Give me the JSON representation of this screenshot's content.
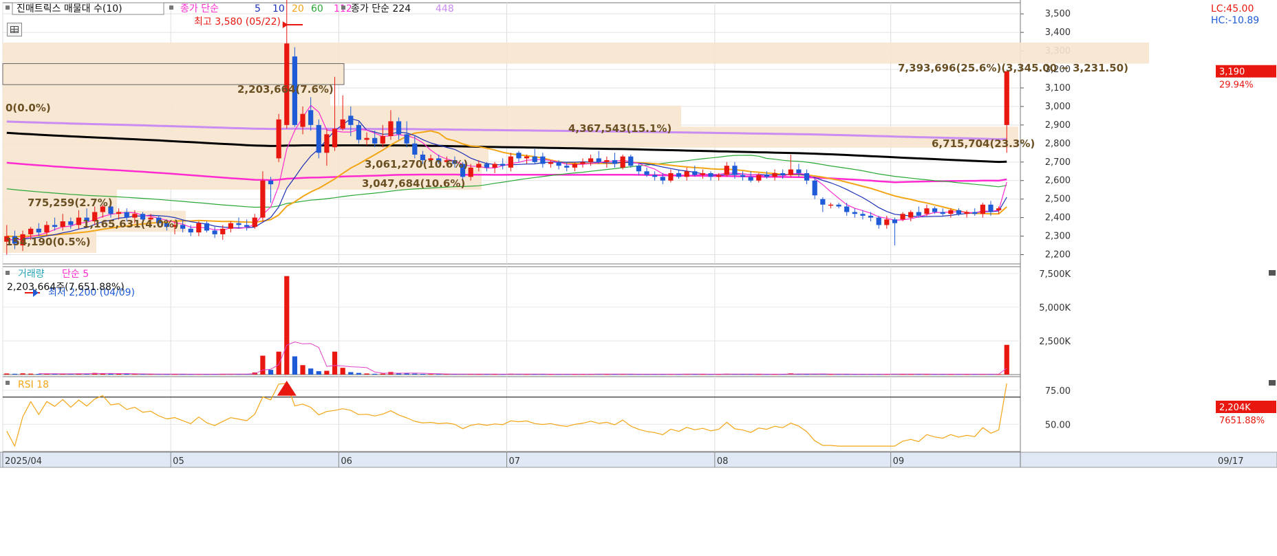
{
  "colors": {
    "up": "#e8170f",
    "down": "#1f5bd6",
    "ma5": "#ff2bd0",
    "ma10": "#1a2fb5",
    "ma20": "#f4a516",
    "ma60": "#2aa836",
    "ma112": "#ff2bd0",
    "ma224": "#000000",
    "ma448": "#c98cf0",
    "band": "#f6e4ce",
    "volma": "#e040c8",
    "rsi": "#f4a516"
  },
  "header": {
    "indicator": "진매트릭스 매물대 수(10)",
    "ma_label": "종가 단순",
    "periods": [
      "5",
      "10",
      "20",
      "60",
      "112"
    ],
    "ma2_label": "종가 단순 224",
    "ma2_extra": "448",
    "lc": "LC:45.00",
    "hc": "HC:-10.89"
  },
  "annotations": {
    "high": "최고 3,580 (05/22)",
    "low": "최저 2,200 (04/09)",
    "volume_info": "2,203,664주(7,651.88%)"
  },
  "price_panel": {
    "price_labels": [
      "3,500",
      "3,400",
      "3,300",
      "3,200",
      "3,100",
      "3,000",
      "2,900",
      "2,800",
      "2,700",
      "2,600",
      "2,500",
      "2,400",
      "2,300",
      "2,200"
    ],
    "last_price": "3,190",
    "change_pct": "29.94%"
  },
  "volume_panel": {
    "title1": "거래량",
    "title2": "단순 5",
    "labels": [
      "7,500K",
      "5,000K",
      "2,500K"
    ],
    "last_vol": "2,204K",
    "last_pct": "7651.88%"
  },
  "rsi_panel": {
    "title": "RSI 18",
    "labels": [
      "75.00",
      "50.00"
    ]
  },
  "date_labels": [
    "2025/04",
    "05",
    "06",
    "07",
    "08",
    "09",
    "09/17"
  ],
  "chart_data": {
    "type": "candlestick",
    "price_range": [
      2150,
      3560
    ],
    "volume_range": [
      0,
      8000000
    ],
    "rsi_range": [
      30,
      85
    ],
    "month_starts": [
      0,
      21,
      42,
      63,
      89,
      111
    ],
    "volume_profile": [
      {
        "label": "7,393,696(25.6%)(3,345.00 ~ 3,231.50)",
        "low": 3231.5,
        "high": 3345
      },
      {
        "label": "2,203,664(7.6%)",
        "low": 3118,
        "high": 3231.5
      },
      {
        "label": "0(0.0%)",
        "low": 3004.5,
        "high": 3118
      },
      {
        "label": "4,367,543(15.1%)",
        "low": 2891,
        "high": 3004.5
      },
      {
        "label": "6,715,704(23.3%)",
        "low": 2777.5,
        "high": 2891
      },
      {
        "label": "3,061,270(10.6%)",
        "low": 2664,
        "high": 2777.5
      },
      {
        "label": "3,047,684(10.6%)",
        "low": 2550.5,
        "high": 2664
      },
      {
        "label": "775,259(2.7%)",
        "low": 2437,
        "high": 2550.5
      },
      {
        "label": "1,165,631(4.0%)",
        "low": 2323.5,
        "high": 2437
      },
      {
        "label": "154,190(0.5%)",
        "low": 2210,
        "high": 2323.5
      }
    ],
    "candles": [
      {
        "o": 2270,
        "h": 2360,
        "l": 2200,
        "c": 2300,
        "v": 80000
      },
      {
        "o": 2300,
        "h": 2330,
        "l": 2230,
        "c": 2260,
        "v": 60000
      },
      {
        "o": 2250,
        "h": 2330,
        "l": 2220,
        "c": 2310,
        "v": 90000
      },
      {
        "o": 2310,
        "h": 2350,
        "l": 2280,
        "c": 2340,
        "v": 70000
      },
      {
        "o": 2340,
        "h": 2370,
        "l": 2300,
        "c": 2320,
        "v": 50000
      },
      {
        "o": 2320,
        "h": 2380,
        "l": 2300,
        "c": 2360,
        "v": 60000
      },
      {
        "o": 2360,
        "h": 2400,
        "l": 2330,
        "c": 2350,
        "v": 50000
      },
      {
        "o": 2350,
        "h": 2420,
        "l": 2330,
        "c": 2380,
        "v": 60000
      },
      {
        "o": 2380,
        "h": 2400,
        "l": 2340,
        "c": 2360,
        "v": 50000
      },
      {
        "o": 2360,
        "h": 2440,
        "l": 2340,
        "c": 2400,
        "v": 80000
      },
      {
        "o": 2400,
        "h": 2450,
        "l": 2370,
        "c": 2380,
        "v": 60000
      },
      {
        "o": 2380,
        "h": 2460,
        "l": 2360,
        "c": 2430,
        "v": 120000
      },
      {
        "o": 2430,
        "h": 2470,
        "l": 2400,
        "c": 2460,
        "v": 90000
      },
      {
        "o": 2460,
        "h": 2480,
        "l": 2400,
        "c": 2420,
        "v": 70000
      },
      {
        "o": 2420,
        "h": 2450,
        "l": 2390,
        "c": 2430,
        "v": 50000
      },
      {
        "o": 2430,
        "h": 2450,
        "l": 2380,
        "c": 2400,
        "v": 50000
      },
      {
        "o": 2400,
        "h": 2440,
        "l": 2370,
        "c": 2420,
        "v": 40000
      },
      {
        "o": 2420,
        "h": 2430,
        "l": 2370,
        "c": 2390,
        "v": 40000
      },
      {
        "o": 2390,
        "h": 2420,
        "l": 2360,
        "c": 2400,
        "v": 40000
      },
      {
        "o": 2400,
        "h": 2410,
        "l": 2350,
        "c": 2370,
        "v": 40000
      },
      {
        "o": 2370,
        "h": 2390,
        "l": 2330,
        "c": 2350,
        "v": 30000
      },
      {
        "o": 2350,
        "h": 2380,
        "l": 2310,
        "c": 2360,
        "v": 30000
      },
      {
        "o": 2360,
        "h": 2390,
        "l": 2320,
        "c": 2340,
        "v": 30000
      },
      {
        "o": 2340,
        "h": 2360,
        "l": 2300,
        "c": 2320,
        "v": 30000
      },
      {
        "o": 2320,
        "h": 2380,
        "l": 2300,
        "c": 2370,
        "v": 40000
      },
      {
        "o": 2370,
        "h": 2380,
        "l": 2320,
        "c": 2330,
        "v": 30000
      },
      {
        "o": 2330,
        "h": 2350,
        "l": 2290,
        "c": 2310,
        "v": 30000
      },
      {
        "o": 2310,
        "h": 2360,
        "l": 2280,
        "c": 2340,
        "v": 40000
      },
      {
        "o": 2340,
        "h": 2380,
        "l": 2320,
        "c": 2370,
        "v": 50000
      },
      {
        "o": 2370,
        "h": 2400,
        "l": 2340,
        "c": 2360,
        "v": 40000
      },
      {
        "o": 2360,
        "h": 2390,
        "l": 2330,
        "c": 2350,
        "v": 40000
      },
      {
        "o": 2350,
        "h": 2420,
        "l": 2340,
        "c": 2400,
        "v": 150000
      },
      {
        "o": 2400,
        "h": 2650,
        "l": 2380,
        "c": 2600,
        "v": 1400000
      },
      {
        "o": 2600,
        "h": 2620,
        "l": 2480,
        "c": 2580,
        "v": 350000
      },
      {
        "o": 2720,
        "h": 2960,
        "l": 2700,
        "c": 2930,
        "v": 1700000
      },
      {
        "o": 2900,
        "h": 3580,
        "l": 2880,
        "c": 3340,
        "v": 7300000
      },
      {
        "o": 3270,
        "h": 3320,
        "l": 2890,
        "c": 2900,
        "v": 1350000
      },
      {
        "o": 2890,
        "h": 3000,
        "l": 2850,
        "c": 2960,
        "v": 700000
      },
      {
        "o": 2980,
        "h": 3050,
        "l": 2870,
        "c": 2900,
        "v": 450000
      },
      {
        "o": 2900,
        "h": 2930,
        "l": 2720,
        "c": 2750,
        "v": 250000
      },
      {
        "o": 2750,
        "h": 2880,
        "l": 2680,
        "c": 2850,
        "v": 280000
      },
      {
        "o": 2780,
        "h": 3160,
        "l": 2760,
        "c": 2880,
        "v": 1700000
      },
      {
        "o": 2880,
        "h": 3060,
        "l": 2870,
        "c": 2930,
        "v": 500000
      },
      {
        "o": 2950,
        "h": 3000,
        "l": 2840,
        "c": 2900,
        "v": 180000
      },
      {
        "o": 2900,
        "h": 2920,
        "l": 2800,
        "c": 2820,
        "v": 120000
      },
      {
        "o": 2820,
        "h": 2860,
        "l": 2790,
        "c": 2830,
        "v": 80000
      },
      {
        "o": 2830,
        "h": 2870,
        "l": 2780,
        "c": 2800,
        "v": 60000
      },
      {
        "o": 2800,
        "h": 2900,
        "l": 2780,
        "c": 2840,
        "v": 70000
      },
      {
        "o": 2840,
        "h": 2980,
        "l": 2820,
        "c": 2920,
        "v": 190000
      },
      {
        "o": 2920,
        "h": 2940,
        "l": 2820,
        "c": 2850,
        "v": 110000
      },
      {
        "o": 2850,
        "h": 2920,
        "l": 2780,
        "c": 2800,
        "v": 100000
      },
      {
        "o": 2800,
        "h": 2840,
        "l": 2720,
        "c": 2740,
        "v": 70000
      },
      {
        "o": 2740,
        "h": 2760,
        "l": 2690,
        "c": 2710,
        "v": 50000
      },
      {
        "o": 2710,
        "h": 2740,
        "l": 2680,
        "c": 2720,
        "v": 40000
      },
      {
        "o": 2720,
        "h": 2740,
        "l": 2690,
        "c": 2700,
        "v": 40000
      },
      {
        "o": 2700,
        "h": 2730,
        "l": 2680,
        "c": 2710,
        "v": 40000
      },
      {
        "o": 2710,
        "h": 2730,
        "l": 2670,
        "c": 2690,
        "v": 40000
      },
      {
        "o": 2690,
        "h": 2700,
        "l": 2600,
        "c": 2620,
        "v": 50000
      },
      {
        "o": 2620,
        "h": 2690,
        "l": 2600,
        "c": 2670,
        "v": 40000
      },
      {
        "o": 2670,
        "h": 2710,
        "l": 2650,
        "c": 2690,
        "v": 30000
      },
      {
        "o": 2690,
        "h": 2700,
        "l": 2650,
        "c": 2670,
        "v": 30000
      },
      {
        "o": 2670,
        "h": 2700,
        "l": 2640,
        "c": 2690,
        "v": 30000
      },
      {
        "o": 2690,
        "h": 2720,
        "l": 2660,
        "c": 2680,
        "v": 30000
      },
      {
        "o": 2670,
        "h": 2750,
        "l": 2650,
        "c": 2730,
        "v": 60000
      },
      {
        "o": 2750,
        "h": 2760,
        "l": 2700,
        "c": 2720,
        "v": 40000
      },
      {
        "o": 2720,
        "h": 2740,
        "l": 2690,
        "c": 2730,
        "v": 30000
      },
      {
        "o": 2730,
        "h": 2770,
        "l": 2690,
        "c": 2700,
        "v": 30000
      },
      {
        "o": 2730,
        "h": 2750,
        "l": 2670,
        "c": 2690,
        "v": 30000
      },
      {
        "o": 2690,
        "h": 2710,
        "l": 2670,
        "c": 2700,
        "v": 30000
      },
      {
        "o": 2700,
        "h": 2710,
        "l": 2660,
        "c": 2680,
        "v": 30000
      },
      {
        "o": 2680,
        "h": 2700,
        "l": 2650,
        "c": 2670,
        "v": 30000
      },
      {
        "o": 2670,
        "h": 2700,
        "l": 2650,
        "c": 2690,
        "v": 30000
      },
      {
        "o": 2690,
        "h": 2720,
        "l": 2670,
        "c": 2700,
        "v": 30000
      },
      {
        "o": 2700,
        "h": 2740,
        "l": 2680,
        "c": 2720,
        "v": 40000
      },
      {
        "o": 2720,
        "h": 2760,
        "l": 2690,
        "c": 2700,
        "v": 40000
      },
      {
        "o": 2700,
        "h": 2730,
        "l": 2670,
        "c": 2710,
        "v": 30000
      },
      {
        "o": 2710,
        "h": 2750,
        "l": 2670,
        "c": 2690,
        "v": 30000
      },
      {
        "o": 2670,
        "h": 2740,
        "l": 2660,
        "c": 2730,
        "v": 40000
      },
      {
        "o": 2730,
        "h": 2740,
        "l": 2670,
        "c": 2680,
        "v": 30000
      },
      {
        "o": 2680,
        "h": 2690,
        "l": 2630,
        "c": 2650,
        "v": 30000
      },
      {
        "o": 2650,
        "h": 2670,
        "l": 2620,
        "c": 2630,
        "v": 30000
      },
      {
        "o": 2630,
        "h": 2650,
        "l": 2600,
        "c": 2620,
        "v": 30000
      },
      {
        "o": 2620,
        "h": 2640,
        "l": 2580,
        "c": 2600,
        "v": 30000
      },
      {
        "o": 2600,
        "h": 2660,
        "l": 2590,
        "c": 2640,
        "v": 40000
      },
      {
        "o": 2640,
        "h": 2660,
        "l": 2610,
        "c": 2620,
        "v": 30000
      },
      {
        "o": 2620,
        "h": 2670,
        "l": 2600,
        "c": 2650,
        "v": 40000
      },
      {
        "o": 2650,
        "h": 2680,
        "l": 2620,
        "c": 2630,
        "v": 30000
      },
      {
        "o": 2630,
        "h": 2660,
        "l": 2610,
        "c": 2640,
        "v": 30000
      },
      {
        "o": 2640,
        "h": 2650,
        "l": 2600,
        "c": 2620,
        "v": 30000
      },
      {
        "o": 2620,
        "h": 2640,
        "l": 2600,
        "c": 2630,
        "v": 30000
      },
      {
        "o": 2630,
        "h": 2700,
        "l": 2620,
        "c": 2680,
        "v": 60000
      },
      {
        "o": 2680,
        "h": 2700,
        "l": 2610,
        "c": 2630,
        "v": 40000
      },
      {
        "o": 2630,
        "h": 2650,
        "l": 2600,
        "c": 2620,
        "v": 30000
      },
      {
        "o": 2620,
        "h": 2650,
        "l": 2590,
        "c": 2600,
        "v": 30000
      },
      {
        "o": 2600,
        "h": 2640,
        "l": 2590,
        "c": 2630,
        "v": 30000
      },
      {
        "o": 2630,
        "h": 2650,
        "l": 2610,
        "c": 2620,
        "v": 30000
      },
      {
        "o": 2620,
        "h": 2660,
        "l": 2600,
        "c": 2640,
        "v": 30000
      },
      {
        "o": 2640,
        "h": 2660,
        "l": 2610,
        "c": 2630,
        "v": 30000
      },
      {
        "o": 2630,
        "h": 2740,
        "l": 2620,
        "c": 2660,
        "v": 90000
      },
      {
        "o": 2660,
        "h": 2690,
        "l": 2620,
        "c": 2640,
        "v": 40000
      },
      {
        "o": 2640,
        "h": 2660,
        "l": 2580,
        "c": 2600,
        "v": 30000
      },
      {
        "o": 2600,
        "h": 2610,
        "l": 2500,
        "c": 2520,
        "v": 50000
      },
      {
        "o": 2500,
        "h": 2510,
        "l": 2430,
        "c": 2470,
        "v": 40000
      },
      {
        "o": 2470,
        "h": 2480,
        "l": 2450,
        "c": 2470,
        "v": 30000
      },
      {
        "o": 2470,
        "h": 2480,
        "l": 2450,
        "c": 2460,
        "v": 30000
      },
      {
        "o": 2460,
        "h": 2480,
        "l": 2410,
        "c": 2430,
        "v": 30000
      },
      {
        "o": 2430,
        "h": 2450,
        "l": 2400,
        "c": 2420,
        "v": 30000
      },
      {
        "o": 2420,
        "h": 2440,
        "l": 2390,
        "c": 2410,
        "v": 30000
      },
      {
        "o": 2410,
        "h": 2430,
        "l": 2380,
        "c": 2400,
        "v": 30000
      },
      {
        "o": 2400,
        "h": 2410,
        "l": 2340,
        "c": 2360,
        "v": 30000
      },
      {
        "o": 2360,
        "h": 2410,
        "l": 2340,
        "c": 2390,
        "v": 30000
      },
      {
        "o": 2390,
        "h": 2400,
        "l": 2250,
        "c": 2370,
        "v": 50000
      },
      {
        "o": 2390,
        "h": 2430,
        "l": 2380,
        "c": 2420,
        "v": 30000
      },
      {
        "o": 2400,
        "h": 2440,
        "l": 2380,
        "c": 2430,
        "v": 30000
      },
      {
        "o": 2430,
        "h": 2460,
        "l": 2400,
        "c": 2410,
        "v": 30000
      },
      {
        "o": 2420,
        "h": 2470,
        "l": 2410,
        "c": 2450,
        "v": 30000
      },
      {
        "o": 2450,
        "h": 2460,
        "l": 2420,
        "c": 2430,
        "v": 30000
      },
      {
        "o": 2430,
        "h": 2450,
        "l": 2410,
        "c": 2420,
        "v": 30000
      },
      {
        "o": 2420,
        "h": 2450,
        "l": 2400,
        "c": 2440,
        "v": 30000
      },
      {
        "o": 2440,
        "h": 2450,
        "l": 2410,
        "c": 2420,
        "v": 30000
      },
      {
        "o": 2420,
        "h": 2440,
        "l": 2400,
        "c": 2430,
        "v": 30000
      },
      {
        "o": 2430,
        "h": 2450,
        "l": 2410,
        "c": 2420,
        "v": 30000
      },
      {
        "o": 2420,
        "h": 2480,
        "l": 2400,
        "c": 2470,
        "v": 40000
      },
      {
        "o": 2470,
        "h": 2490,
        "l": 2410,
        "c": 2430,
        "v": 30000
      },
      {
        "o": 2440,
        "h": 2460,
        "l": 2420,
        "c": 2450,
        "v": 30000
      },
      {
        "o": 2900,
        "h": 3190,
        "l": 2750,
        "c": 3190,
        "v": 2203664
      }
    ]
  }
}
